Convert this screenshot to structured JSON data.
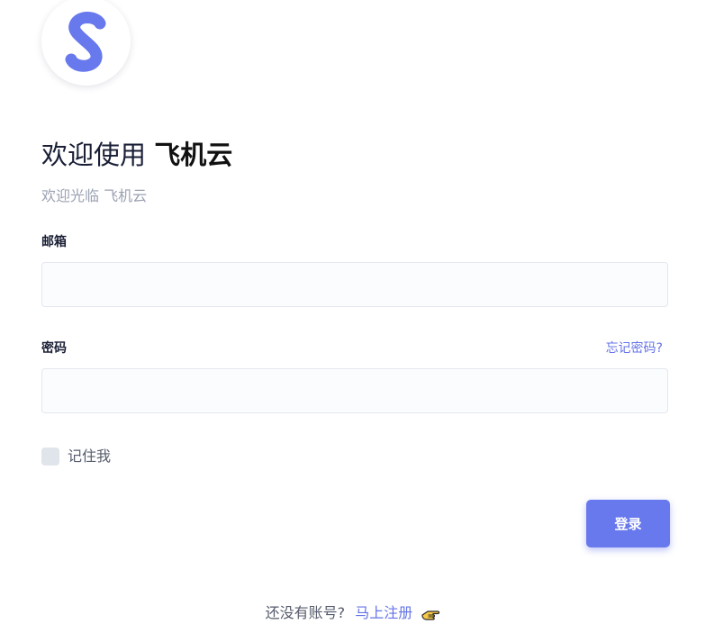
{
  "brand": {
    "logo_letter": "S",
    "accent_color": "#6878ed"
  },
  "header": {
    "title_prefix": "欢迎使用",
    "title_brand": "飞机云",
    "subtitle": "欢迎光临 飞机云"
  },
  "form": {
    "email_label": "邮箱",
    "email_value": "",
    "password_label": "密码",
    "password_value": "",
    "forgot_label": "忘记密码?",
    "remember_label": "记住我",
    "remember_checked": false,
    "submit_label": "登录"
  },
  "footer": {
    "prompt": "还没有账号?",
    "signup_label": "马上注册",
    "signup_icon": "pointing-hand-icon"
  }
}
